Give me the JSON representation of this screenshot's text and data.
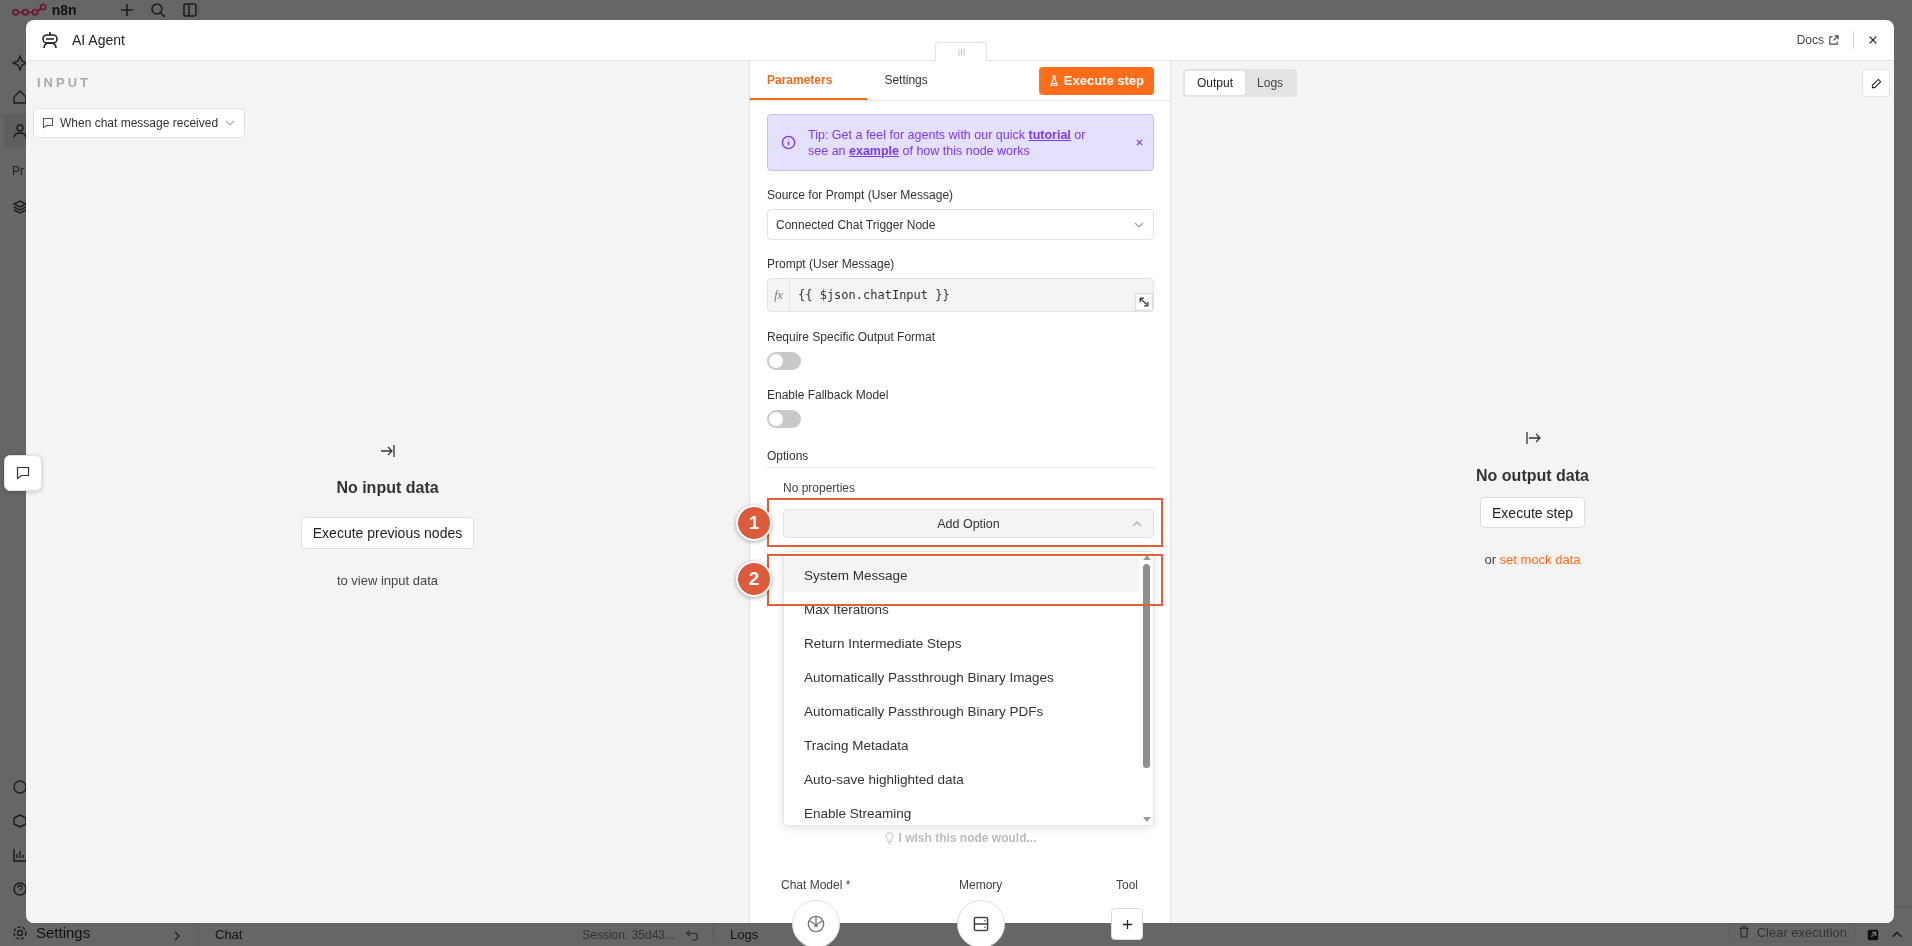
{
  "app": {
    "logo_text": "n8n",
    "sidebar_section": "Pr",
    "sidebar_footer": "Settings"
  },
  "bottom_bar": {
    "chat_label": "Chat",
    "session": "Session: 35d43...",
    "logs_label": "Logs",
    "clear_button": "Clear execution"
  },
  "modal": {
    "title": "AI Agent",
    "docs_link": "Docs"
  },
  "input_panel": {
    "heading": "INPUT",
    "trigger_select": "When chat message received",
    "empty_title": "No input data",
    "execute_button": "Execute previous nodes",
    "hint": "to view input data"
  },
  "parameters_panel": {
    "tabs": [
      {
        "label": "Parameters",
        "selected": true
      },
      {
        "label": "Settings",
        "selected": false
      }
    ],
    "execute_button": "Execute step",
    "tip": [
      {
        "kind": "text",
        "text": "Tip: Get a feel for agents with our quick "
      },
      {
        "kind": "link",
        "text": "tutorial"
      },
      {
        "kind": "text",
        "text": " or see an "
      },
      {
        "kind": "link",
        "text": "example"
      },
      {
        "kind": "text",
        "text": " of how this node works"
      }
    ],
    "fields": [
      {
        "kind": "select",
        "label": "Source for Prompt (User Message)",
        "value": "Connected Chat Trigger Node"
      },
      {
        "kind": "expression",
        "label": "Prompt (User Message)",
        "prefix": "fx",
        "value": "{{ $json.chatInput }}"
      },
      {
        "kind": "toggle",
        "label": "Require Specific Output Format",
        "on": false
      },
      {
        "kind": "toggle",
        "label": "Enable Fallback Model",
        "on": false
      }
    ],
    "options": {
      "heading": "Options",
      "empty": "No properties",
      "add_button": "Add Option",
      "expanded": true,
      "menu": [
        {
          "label": "System Message",
          "selected": true
        },
        {
          "label": "Max Iterations",
          "selected": false
        },
        {
          "label": "Return Intermediate Steps",
          "selected": false
        },
        {
          "label": "Automatically Passthrough Binary Images",
          "selected": false
        },
        {
          "label": "Automatically Passthrough Binary PDFs",
          "selected": false
        },
        {
          "label": "Tracing Metadata",
          "selected": false
        },
        {
          "label": "Auto-save highlighted data",
          "selected": false
        },
        {
          "label": "Enable Streaming",
          "selected": false
        }
      ]
    },
    "feedback": "I wish this node would...",
    "connectors": [
      {
        "kind": "model",
        "label": "Chat Model *"
      },
      {
        "kind": "memory",
        "label": "Memory"
      },
      {
        "kind": "add",
        "label": "Tool"
      }
    ]
  },
  "output_panel": {
    "tabs": [
      {
        "label": "Output",
        "selected": true
      },
      {
        "label": "Logs",
        "selected": false
      }
    ],
    "empty_title": "No output data",
    "execute_button": "Execute step",
    "mock_prefix": "or",
    "mock_link": "set mock data"
  },
  "annotations": [
    {
      "label": "1"
    },
    {
      "label": "2"
    }
  ]
}
